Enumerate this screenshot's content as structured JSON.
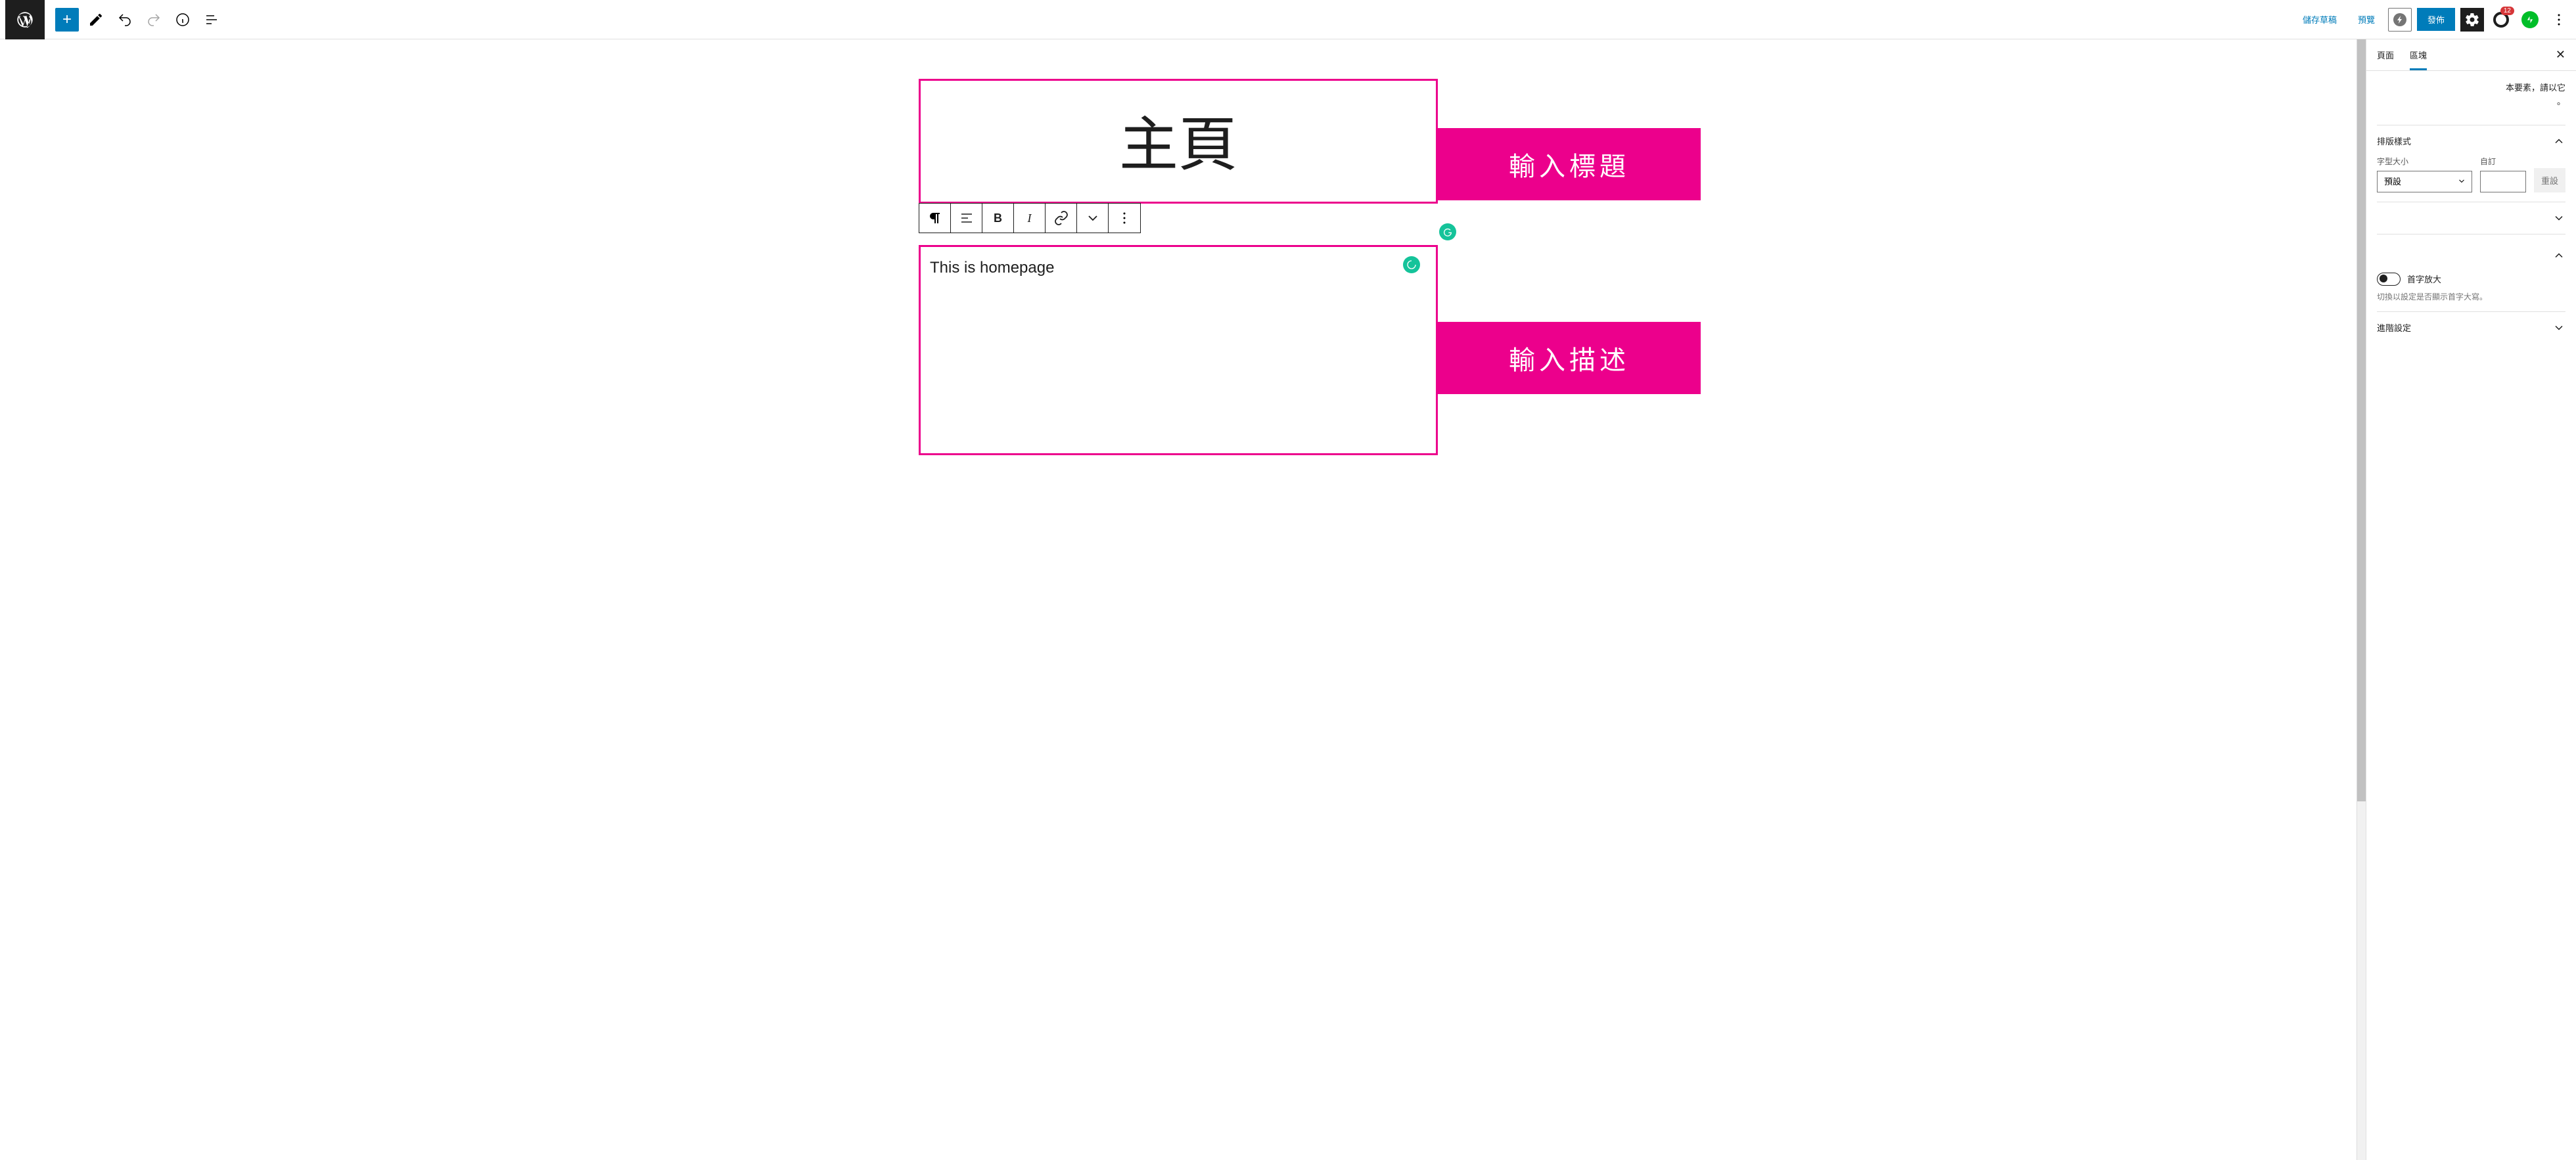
{
  "topbar": {
    "save_draft": "儲存草稿",
    "preview": "預覽",
    "publish": "發佈",
    "yoast_badge": "12"
  },
  "canvas": {
    "title": "主頁",
    "content": "This is homepage"
  },
  "annotations": {
    "title_hint": "輸入標題",
    "desc_hint": "輸入描述"
  },
  "sidebar": {
    "tab_page": "頁面",
    "tab_block": "區塊",
    "partial_text_1": "本要素，請以它",
    "partial_text_2": "。",
    "typography": {
      "heading": "排版樣式",
      "font_size_label": "字型大小",
      "custom_label": "自訂",
      "preset_value": "預設",
      "reset": "重設"
    },
    "dropcap": {
      "label": "首字放大",
      "hint": "切換以設定是否顯示首字大寫。"
    },
    "advanced": "進階設定"
  }
}
